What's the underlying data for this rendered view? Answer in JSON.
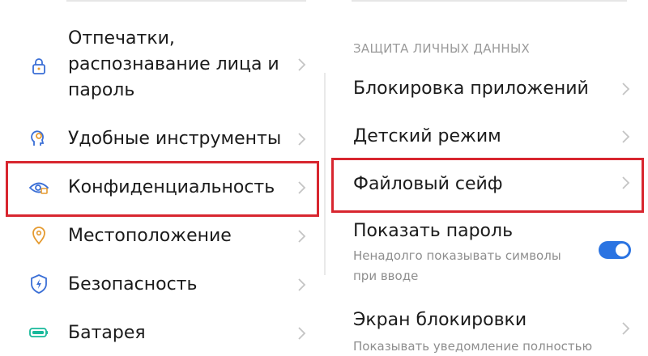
{
  "left": {
    "items": [
      {
        "label_lines": [
          "Отпечатки,",
          "распознавание лица и",
          "пароль"
        ],
        "icon": "lock-icon"
      },
      {
        "label": "Удобные инструменты",
        "icon": "head-gear-icon"
      },
      {
        "label": "Конфиденциальность",
        "icon": "privacy-eye-icon"
      },
      {
        "label": "Местоположение",
        "icon": "location-pin-icon"
      },
      {
        "label": "Безопасность",
        "icon": "shield-bolt-icon"
      },
      {
        "label": "Батарея",
        "icon": "battery-icon"
      }
    ]
  },
  "right": {
    "section_header": "ЗАЩИТА ЛИЧНЫХ ДАННЫХ",
    "items": [
      {
        "label": "Блокировка приложений"
      },
      {
        "label": "Детский режим"
      },
      {
        "label": "Файловый сейф"
      },
      {
        "label": "Показать пароль",
        "sub_lines": [
          "Ненадолго показывать символы",
          "при вводе"
        ],
        "toggle_on": true
      },
      {
        "label": "Экран блокировки",
        "sub": "Показывать уведомление полностью"
      }
    ]
  },
  "colors": {
    "accent": "#2b74e2",
    "highlight": "#d8262f",
    "icon_blue": "#3b6fd6",
    "icon_orange": "#e59a2f",
    "icon_teal": "#18b99b"
  }
}
